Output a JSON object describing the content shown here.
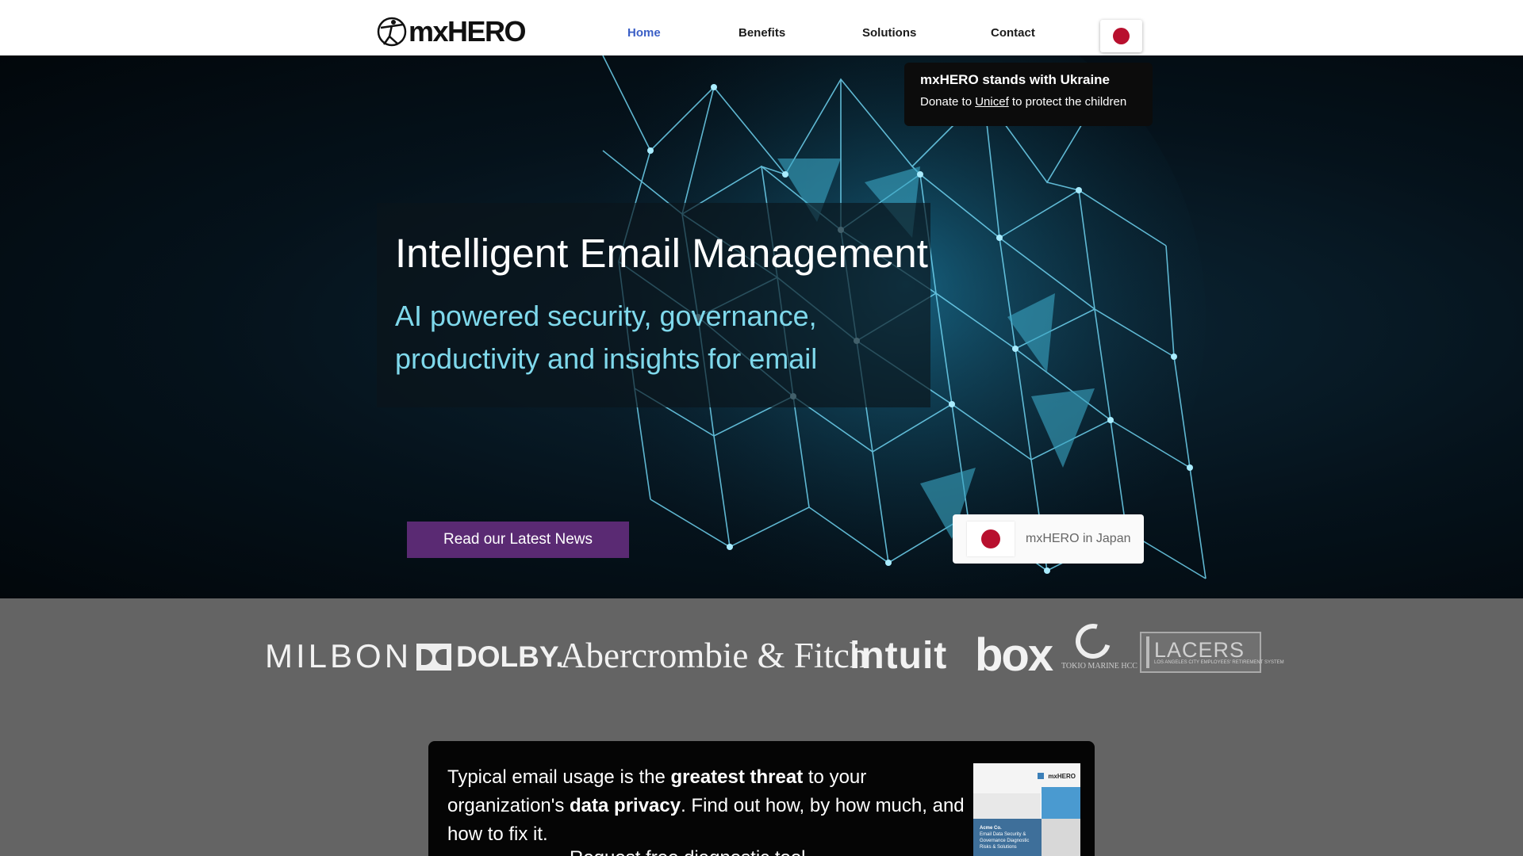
{
  "header": {
    "logo_text": "mxHERO",
    "nav": [
      {
        "label": "Home",
        "active": true
      },
      {
        "label": "Benefits",
        "active": false
      },
      {
        "label": "Solutions",
        "active": false
      },
      {
        "label": "Contact",
        "active": false
      }
    ],
    "language_flag_icon": "japan-flag-icon"
  },
  "ukraine": {
    "title": "mxHERO stands with Ukraine",
    "line_before": "Donate to",
    "link": "Unicef",
    "line_after": "to protect the children"
  },
  "hero": {
    "title": "Intelligent Email Management",
    "subtitle": "AI powered security, governance, productivity and insights for email",
    "news_button": "Read our Latest News",
    "japan_button": "mxHERO in Japan"
  },
  "clients": {
    "milbon": "MILBON",
    "dolby": "DOLBY.",
    "abercrombie": "Abercrombie & Fitch",
    "intuit": "intuit",
    "box": "box",
    "tokio": "TOKIO MARINE HCC",
    "lacers": "LACERS",
    "lacers_sub": "LOS ANGELES CITY EMPLOYEES' RETIREMENT SYSTEM"
  },
  "promo": {
    "text_1": "Typical email usage is the",
    "bold_1": "greatest threat",
    "text_2": "to your organization's",
    "bold_2": "data privacy",
    "text_3": ". Find out how, by how much, and how to fix it.",
    "cut_line": "Request free diagnostic tool",
    "doc_brand": "mxHERO",
    "doc_company": "Acme Co.",
    "doc_line1": "Email Data Security &",
    "doc_line2": "Governance Diagnostic",
    "doc_line3": "Risks & Solutions"
  },
  "colors": {
    "nav_active": "#3b5fc6",
    "news_button": "#5a2a73",
    "subtitle": "#7fd9ec",
    "japan_red": "#b8102e"
  }
}
